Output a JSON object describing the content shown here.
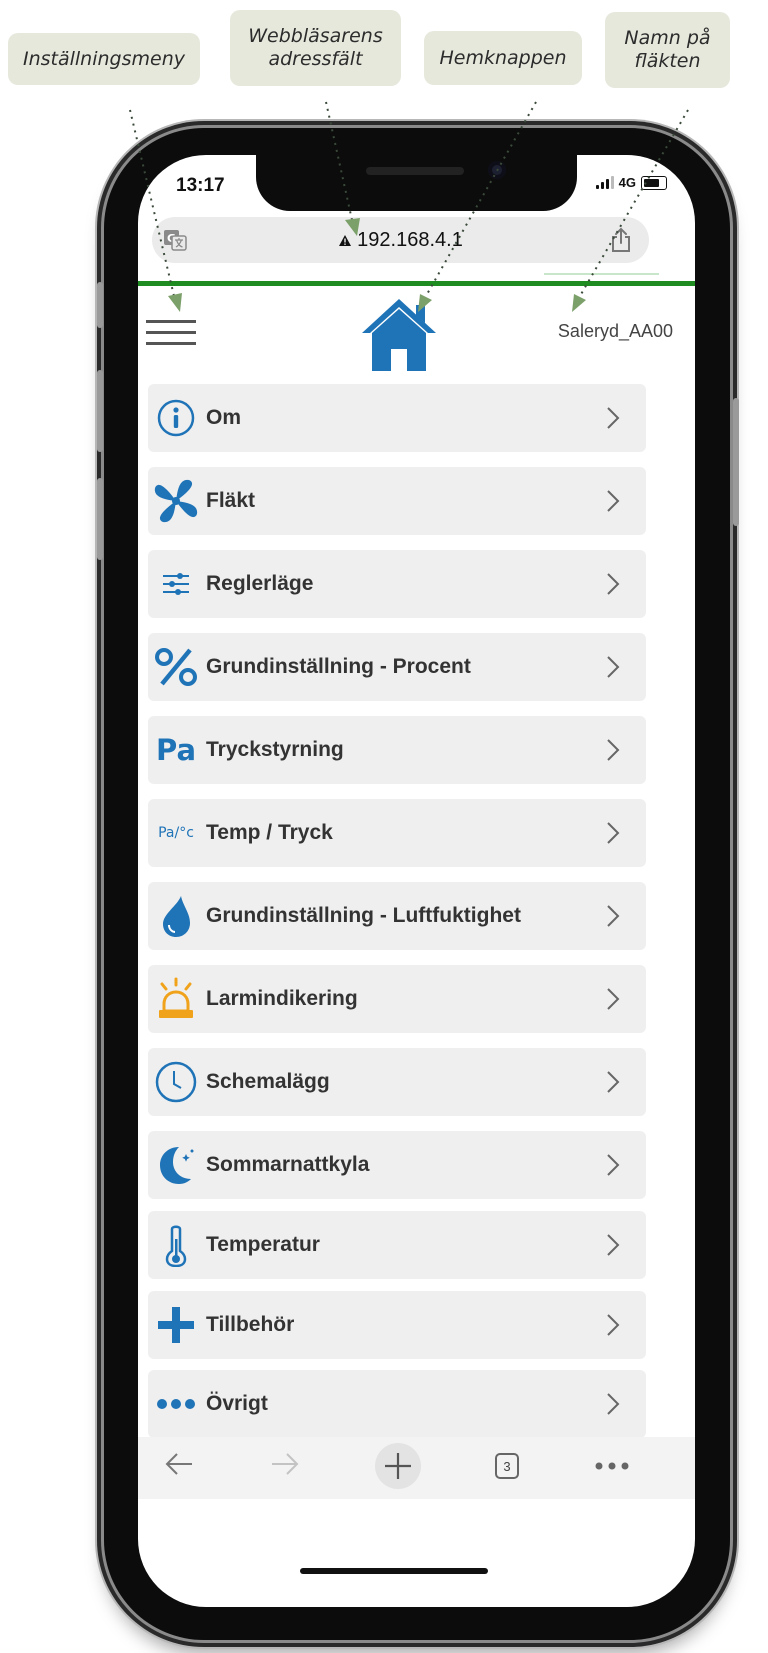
{
  "callouts": {
    "settings_menu": "Inställningsmeny",
    "address_bar_line1": "Webbläsarens",
    "address_bar_line2": "adressfält",
    "home_button": "Hemknappen",
    "fan_name_line1": "Namn på",
    "fan_name_line2": "fläkten"
  },
  "status_bar": {
    "time": "13:17",
    "network": "4G"
  },
  "browser": {
    "url": "192.168.4.1"
  },
  "header": {
    "fan_name": "Saleryd_AA00"
  },
  "menu": {
    "items": [
      {
        "label": "Om",
        "icon": "info-icon"
      },
      {
        "label": "Fläkt",
        "icon": "fan-icon"
      },
      {
        "label": "Reglerläge",
        "icon": "sliders-icon"
      },
      {
        "label": "Grundinställning - Procent",
        "icon": "percent-icon"
      },
      {
        "label": "Tryckstyrning",
        "icon": "pressure-pa-icon"
      },
      {
        "label": "Temp / Tryck",
        "icon": "pa-celsius-icon"
      },
      {
        "label": "Grundinställning - Luftfuktighet",
        "icon": "water-drop-icon"
      },
      {
        "label": "Larmindikering",
        "icon": "alarm-light-icon"
      },
      {
        "label": "Schemalägg",
        "icon": "clock-icon"
      },
      {
        "label": "Sommarnattkyla",
        "icon": "moon-stars-icon"
      },
      {
        "label": "Temperatur",
        "icon": "thermometer-icon"
      },
      {
        "label": "Tillbehör",
        "icon": "plus-icon"
      },
      {
        "label": "Övrigt",
        "icon": "dots-icon"
      }
    ],
    "icon_labels": {
      "pa": "Pa",
      "pa_c": "Pa/°c"
    }
  },
  "toolbar": {
    "tab_count": "3"
  },
  "colors": {
    "accent_blue": "#1f73b7",
    "accent_green": "#1f8c22",
    "alarm_orange": "#f0a31a",
    "callout_bg": "#e6e8dc"
  }
}
